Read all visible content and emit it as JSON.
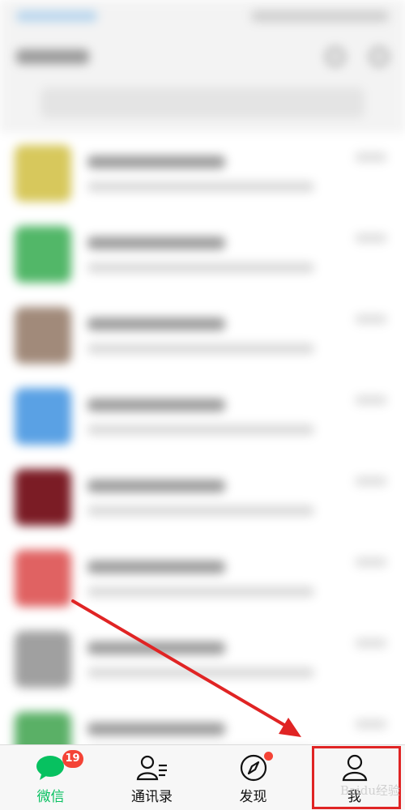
{
  "tabs": [
    {
      "label": "微信",
      "badge": "19",
      "icon": "chat-bubble-icon",
      "active": true
    },
    {
      "label": "通讯录",
      "icon": "contacts-icon"
    },
    {
      "label": "发现",
      "icon": "compass-icon",
      "has_dot": true
    },
    {
      "label": "我",
      "icon": "person-icon"
    }
  ],
  "colors": {
    "accent": "#07c160",
    "badge": "#f44336",
    "annotation": "#e02424"
  },
  "watermark": "Baidu经验",
  "blurred_avatar_colors": [
    "#d7c85c",
    "#52b768",
    "#a18a7a",
    "#5aa1e4",
    "#7b1c25",
    "#e06262",
    "#a0a0a0",
    "#5ab066"
  ]
}
